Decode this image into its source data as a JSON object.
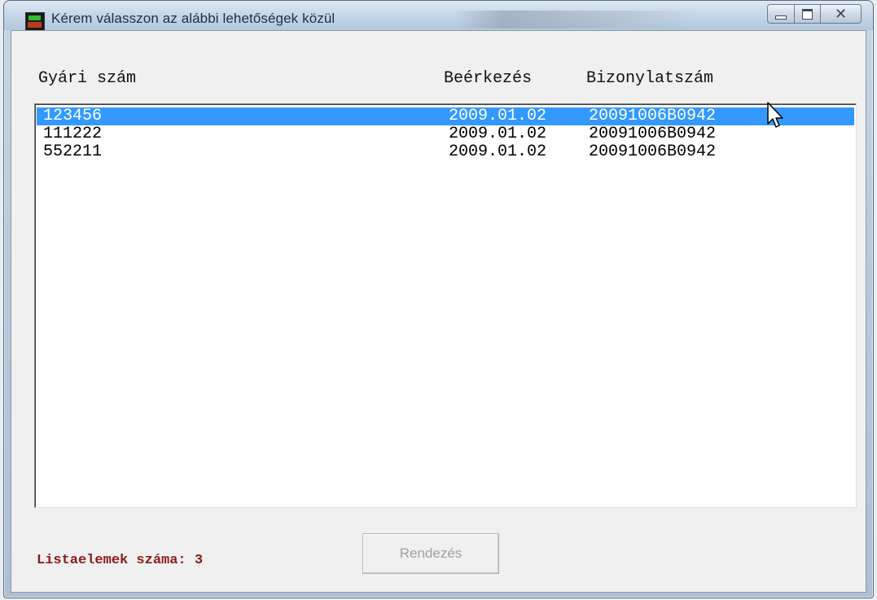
{
  "window": {
    "title": "Kérem válasszon az alábbi lehetőségek közül"
  },
  "list": {
    "columns": [
      "Gyári szám",
      "Beérkezés",
      "Bizonylatszám"
    ],
    "rows": [
      {
        "serial": "123456",
        "arrival": "2009.01.02",
        "document": "20091006B0942",
        "selected": true
      },
      {
        "serial": "111222",
        "arrival": "2009.01.02",
        "document": "20091006B0942",
        "selected": false
      },
      {
        "serial": "552211",
        "arrival": "2009.01.02",
        "document": "20091006B0942",
        "selected": false
      }
    ]
  },
  "footer": {
    "count_label": "Listaelemek száma: 3",
    "sort_button": "Rendezés"
  },
  "colors": {
    "selection": "#3399ff",
    "count_label": "#8b1a1a"
  },
  "icons": [
    "app-icon",
    "minimize-icon",
    "maximize-icon",
    "close-icon",
    "mouse-cursor-icon"
  ]
}
